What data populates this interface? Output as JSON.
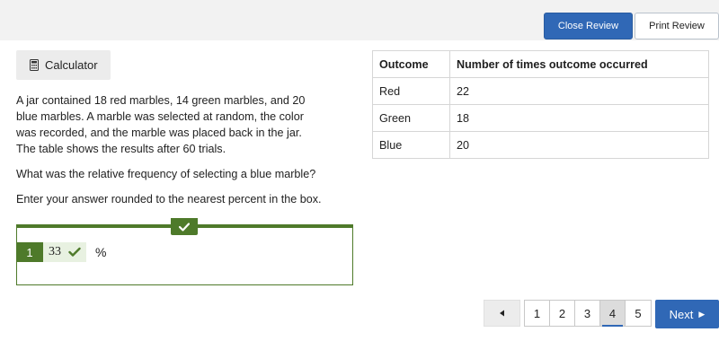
{
  "header": {
    "close_review_label": "Close Review",
    "print_review_label": "Print Review"
  },
  "toolbar": {
    "calculator_label": "Calculator"
  },
  "question": {
    "paragraph_1": "A jar contained 18 red marbles, 14 green marbles, and 20 blue marbles. A marble was selected at random, the color was recorded, and the marble was placed back in the jar. The table shows the results after 60 trials.",
    "paragraph_2": "What was the relative frequency of selecting a blue marble?",
    "paragraph_3": "Enter your answer rounded to the nearest percent in the box."
  },
  "answer": {
    "number": "1",
    "value": "33",
    "unit": "%",
    "status": "correct"
  },
  "table": {
    "headers": [
      "Outcome",
      "Number of times outcome occurred"
    ],
    "rows": [
      [
        "Red",
        "22"
      ],
      [
        "Green",
        "18"
      ],
      [
        "Blue",
        "20"
      ]
    ]
  },
  "pagination": {
    "pages": [
      "1",
      "2",
      "3",
      "4",
      "5"
    ],
    "current_page": "4",
    "next_label": "Next"
  },
  "colors": {
    "primary_blue": "#3068b6",
    "correct_green": "#4e7a2a",
    "answer_bg": "#e8f1e1"
  }
}
